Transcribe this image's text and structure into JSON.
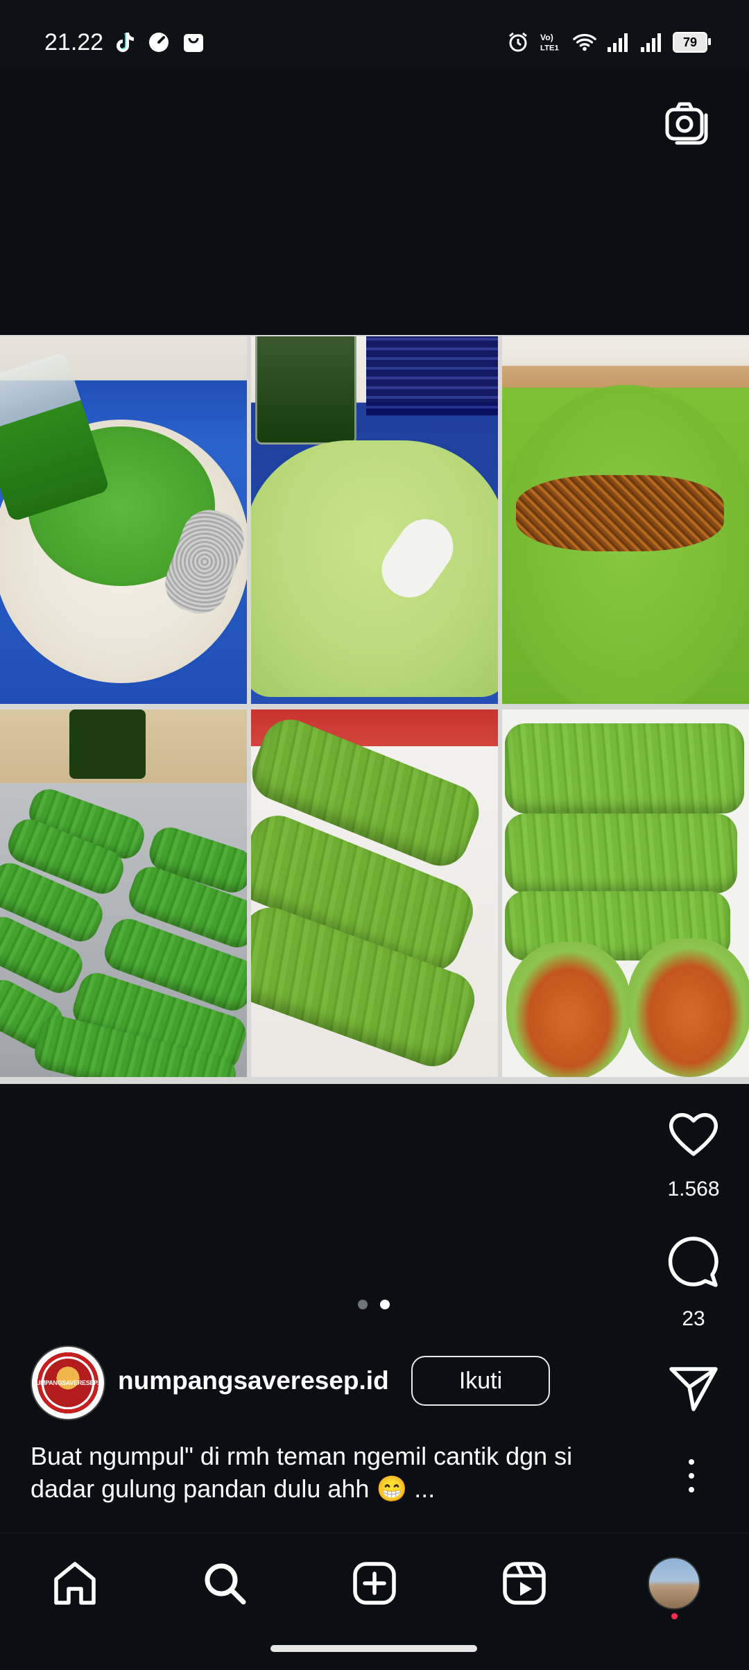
{
  "status_bar": {
    "time": "21.22",
    "left_icons": [
      "tiktok-icon",
      "speedometer-icon",
      "shopping-bag-icon"
    ],
    "right_icons": [
      "alarm-icon",
      "volte-icon",
      "wifi-icon",
      "signal-icon",
      "signal-icon"
    ],
    "volte_label": "Vo) LTE1",
    "battery": "79"
  },
  "post": {
    "carousel_dots": 2,
    "active_dot": 2,
    "likes": "1.568",
    "comments": "23",
    "account": {
      "username": "numpangsaveresep.id",
      "avatar_text": "NUMPANGSAVERESEP.ID",
      "follow_label": "Ikuti"
    },
    "caption": "Buat ngumpul\" di rmh teman ngemil cantik dgn si dadar gulung pandan dulu ahh 😁 ..."
  },
  "nav": {
    "items": [
      "home-icon",
      "search-icon",
      "create-icon",
      "reels-icon",
      "profile-avatar"
    ]
  },
  "colors": {
    "background": "#0b0f14",
    "text": "#ffffff",
    "notification_dot": "#ff2d55"
  }
}
